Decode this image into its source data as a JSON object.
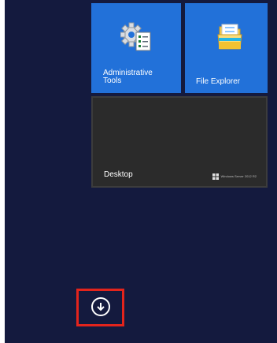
{
  "start_screen": {
    "background_color": "#141a3e",
    "tiles": [
      {
        "label": "Administrative\nTools",
        "icon": "admin-tools-icon",
        "color": "#2271d9"
      },
      {
        "label": "File Explorer",
        "icon": "folder-icon",
        "color": "#2271d9"
      },
      {
        "label": "Desktop",
        "brand": "Windows Server 2012 R2",
        "color": "#2b2b2b"
      }
    ],
    "apps_button": {
      "icon": "down-arrow-circle-icon",
      "highlight_color": "#e3241c"
    }
  }
}
